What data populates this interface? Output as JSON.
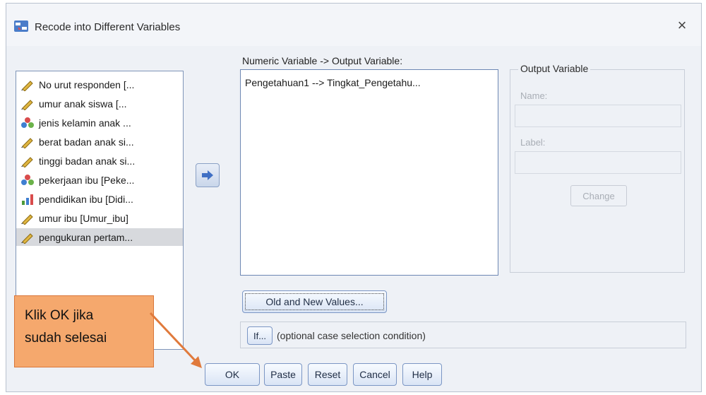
{
  "window": {
    "title": "Recode into Different Variables",
    "close_label": "×"
  },
  "variables": {
    "items": [
      {
        "label": "No urut responden [...",
        "type": "scale",
        "selected": false
      },
      {
        "label": "umur anak siswa [...",
        "type": "scale",
        "selected": false
      },
      {
        "label": "jenis kelamin anak ...",
        "type": "nominal",
        "selected": false
      },
      {
        "label": "berat badan anak si...",
        "type": "scale",
        "selected": false
      },
      {
        "label": "tinggi badan anak si...",
        "type": "scale",
        "selected": false
      },
      {
        "label": "pekerjaan ibu [Peke...",
        "type": "nominal",
        "selected": false
      },
      {
        "label": "pendidikan ibu [Didi...",
        "type": "ordinal",
        "selected": false
      },
      {
        "label": "umur ibu [Umur_ibu]",
        "type": "scale",
        "selected": false
      },
      {
        "label": "pengukuran pertam...",
        "type": "scale",
        "selected": true
      }
    ]
  },
  "mapping": {
    "label": "Numeric Variable -> Output Variable:",
    "items": [
      "Pengetahuan1 --> Tingkat_Pengetahu..."
    ]
  },
  "output_variable": {
    "group_label": "Output Variable",
    "name_label": "Name:",
    "name_value": "",
    "label_label": "Label:",
    "label_value": "",
    "change_label": "Change"
  },
  "buttons": {
    "old_new": "Old and New Values...",
    "if": "If...",
    "if_caption": "(optional case selection condition)",
    "ok": "OK",
    "paste": "Paste",
    "reset": "Reset",
    "cancel": "Cancel",
    "help": "Help"
  },
  "callout": {
    "line1": "Klik OK jika",
    "line2": "sudah selesai"
  },
  "colors": {
    "callout_fill": "#f5a86d",
    "arrow": "#e07a3c",
    "move_arrow": "#3f6fc4"
  }
}
